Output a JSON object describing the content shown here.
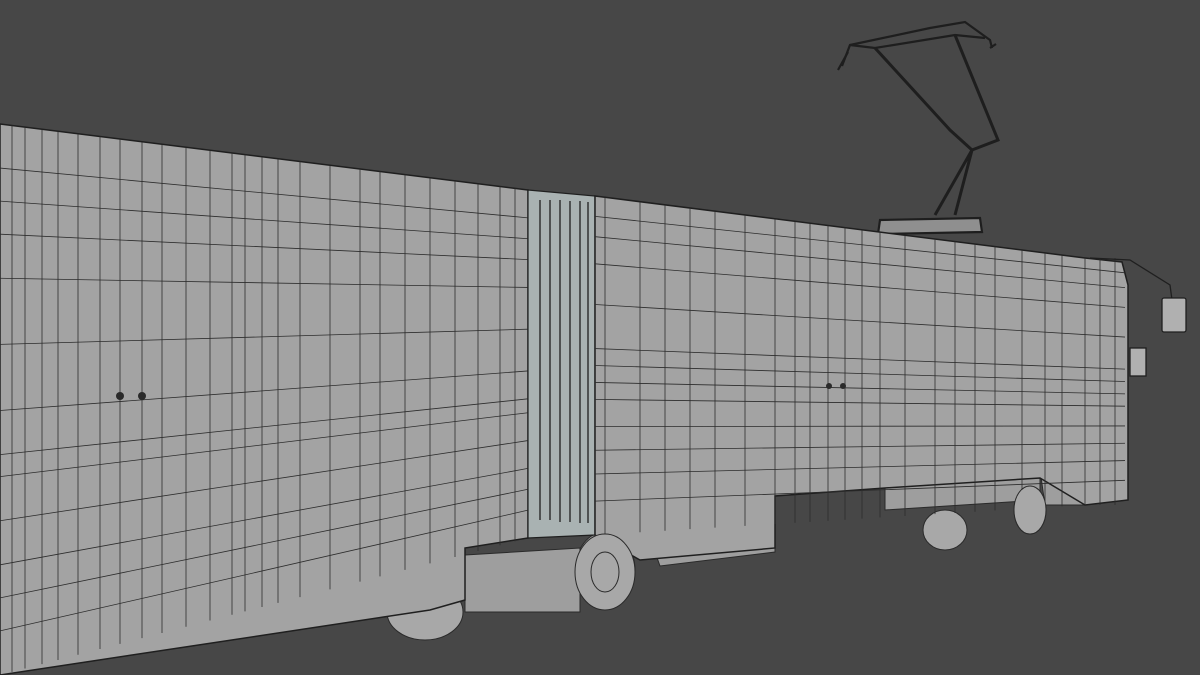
{
  "scene": {
    "subject": "tram-wireframe-render",
    "colors": {
      "background": "#474747",
      "body_fill": "#a3a3a3",
      "body_fill_dark": "#9a9a9a",
      "wire": "#2a2a2a",
      "joint_fill": "#a9b2b2",
      "wheel_fill": "#a8a8a8",
      "pantograph": "#1e1e1e"
    }
  }
}
